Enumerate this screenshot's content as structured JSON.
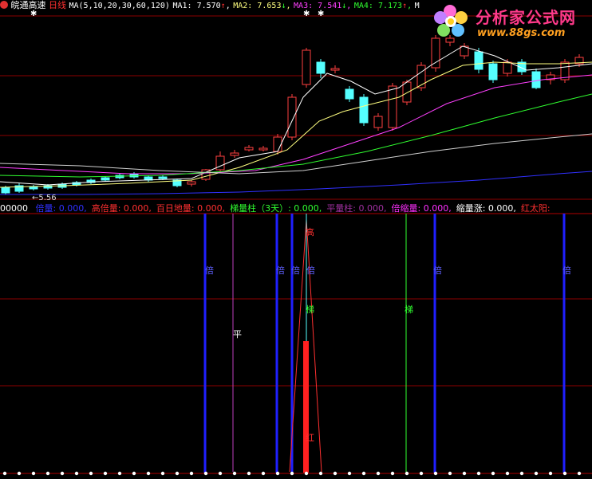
{
  "top_bar": {
    "stock_name": "皖通高速",
    "period": "日线",
    "ma_params": "MA(5,10,20,30,60,120)",
    "ma1_label": "MA1:",
    "ma1_value": "7.570",
    "ma1_arrow": "↑",
    "ma2_label": "MA2:",
    "ma2_value": "7.653",
    "ma2_arrow": "↓",
    "ma3_label": "MA3:",
    "ma3_value": "7.541",
    "ma3_arrow": "↓",
    "ma4_label": "MA4:",
    "ma4_value": "7.173",
    "ma4_arrow": "↑",
    "ma5_label": "M"
  },
  "watermark": {
    "title": "分析家公式网",
    "url": "www.88gs.com"
  },
  "min_price_label": "5.56",
  "indicator_bar": {
    "prefix": "00000",
    "items": [
      {
        "label": "倍量:",
        "value": "0.000,",
        "color": "#3030ff"
      },
      {
        "label": "高倍量:",
        "value": "0.000,",
        "color": "#ff3030"
      },
      {
        "label": "百日地量:",
        "value": "0.000,",
        "color": "#ff3030"
      },
      {
        "label": "梯量柱（3天）:",
        "value": "0.000,",
        "color": "#30ff30"
      },
      {
        "label": "平量柱:",
        "value": "0.000,",
        "color": "#a030a0"
      },
      {
        "label": "倍缩量:",
        "value": "0.000,",
        "color": "#ff30ff"
      },
      {
        "label": "缩量涨:",
        "value": "0.000,",
        "color": "#ffffff"
      },
      {
        "label": "红太阳:",
        "value": "",
        "color": "#ff3030"
      }
    ]
  },
  "markers": {
    "bei": "倍",
    "ping": "平",
    "ti": "梯",
    "gao": "高",
    "hong": "红"
  },
  "colors": {
    "up": "#ff4040",
    "down": "#55ffff",
    "ma1": "#ffffff",
    "ma2": "#ffff80",
    "ma3": "#ff40ff",
    "ma4": "#30ff30",
    "ma5": "#d0d0d0",
    "ma6": "#3030ff",
    "grid": "#8b0000"
  }
}
